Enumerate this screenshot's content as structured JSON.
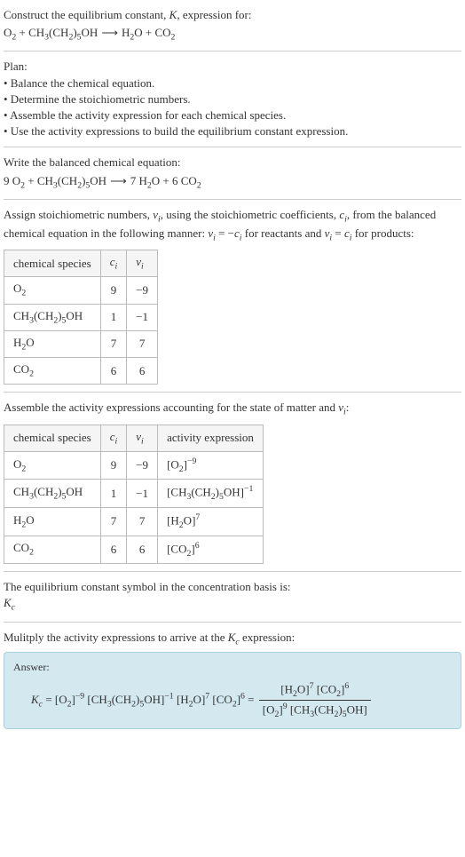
{
  "intro": {
    "line1_pre": "Construct the equilibrium constant, ",
    "line1_K": "K",
    "line1_post": ", expression for:",
    "eq_lhs1": "O",
    "eq_lhs1_sub": "2",
    "eq_plus": " + ",
    "eq_lhs2a": "CH",
    "eq_lhs2a_sub": "3",
    "eq_lhs2b": "(CH",
    "eq_lhs2b_sub": "2",
    "eq_lhs2c": ")",
    "eq_lhs2c_sub": "5",
    "eq_lhs2d": "OH",
    "eq_arrow": " ⟶ ",
    "eq_rhs1": "H",
    "eq_rhs1_sub": "2",
    "eq_rhs1b": "O",
    "eq_rhs2": "CO",
    "eq_rhs2_sub": "2"
  },
  "plan": {
    "heading": "Plan:",
    "b1": "• Balance the chemical equation.",
    "b2": "• Determine the stoichiometric numbers.",
    "b3": "• Assemble the activity expression for each chemical species.",
    "b4": "• Use the activity expressions to build the equilibrium constant expression."
  },
  "balanced": {
    "heading": "Write the balanced chemical equation:",
    "c1": "9 ",
    "c2": "7 ",
    "c3": "6 "
  },
  "stoich_text": {
    "p1": "Assign stoichiometric numbers, ",
    "nu": "ν",
    "sub_i": "i",
    "p2": ", using the stoichiometric coefficients, ",
    "c": "c",
    "p3": ", from the balanced chemical equation in the following manner: ",
    "eq1a": " = −",
    "p4": " for reactants and ",
    "eq2a": " = ",
    "p5": " for products:"
  },
  "table1": {
    "h1": "chemical species",
    "h2": "cᵢ",
    "h3": "νᵢ",
    "r1c1_a": "O",
    "r1c1_sub": "2",
    "r1c2": "9",
    "r1c3": "−9",
    "r2c2": "1",
    "r2c3": "−1",
    "r3c1_a": "H",
    "r3c1_sub": "2",
    "r3c1_b": "O",
    "r3c2": "7",
    "r3c3": "7",
    "r4c1_a": "CO",
    "r4c1_sub": "2",
    "r4c2": "6",
    "r4c3": "6"
  },
  "assemble": {
    "text_pre": "Assemble the activity expressions accounting for the state of matter and ",
    "text_post": ":"
  },
  "table2": {
    "h4": "activity expression",
    "r1_exp": "−9",
    "r2_exp": "−1",
    "r3_exp": "7",
    "r4_exp": "6"
  },
  "symbol": {
    "line1": "The equilibrium constant symbol in the concentration basis is:",
    "K": "K",
    "sub_c": "c"
  },
  "multiply": {
    "text_pre": "Mulitply the activity expressions to arrive at the ",
    "text_post": " expression:"
  },
  "answer": {
    "label": "Answer:",
    "eq_equals": " = ",
    "open": "[",
    "close": "]"
  }
}
